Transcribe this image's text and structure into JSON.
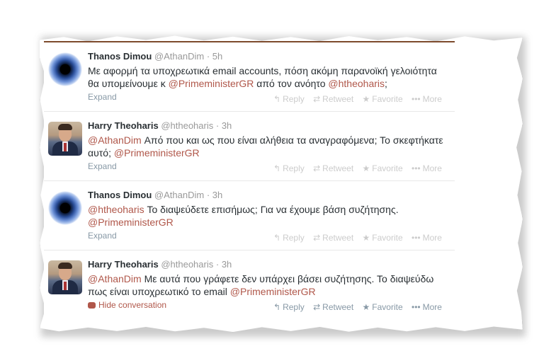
{
  "tweets": [
    {
      "name": "Thanos Dimou",
      "handle": "@AthanDim",
      "time": "5h",
      "avatar": "eye-avatar",
      "text_parts": [
        "Με αφορμή τα υποχρεωτικά email accounts, πόση ακόμη παρανοϊκή γελοιότητα θα υπομείνουμε κ ",
        "@PrimeministerGR",
        " από τον ανόητο ",
        "@htheoharis",
        ";"
      ],
      "footer_link": "Expand"
    },
    {
      "name": "Harry Theoharis",
      "handle": "@htheoharis",
      "time": "3h",
      "avatar": "portrait-avatar",
      "text_parts": [
        "@AthanDim",
        " Από που και ως που είναι αλήθεια τα αναγραφόμενα; Το σκεφτήκατε αυτό; ",
        "@PrimeministerGR"
      ],
      "footer_link": "Expand"
    },
    {
      "name": "Thanos Dimou",
      "handle": "@AthanDim",
      "time": "3h",
      "avatar": "eye-avatar",
      "text_parts": [
        "@htheoharis",
        " Το διαψεύδετε επισήμως; Για να έχουμε βάση συζήτησης. ",
        "@PrimeministerGR"
      ],
      "footer_link": "Expand"
    },
    {
      "name": "Harry Theoharis",
      "handle": "@htheoharis",
      "time": "3h",
      "avatar": "portrait-avatar",
      "text_parts": [
        "@AthanDim",
        " Με αυτά που γράφετε δεν υπάρχει βάσει συζήτησης. Το διαψεύδω πως είναι υποχρεωτικό το email ",
        "@PrimeministerGR"
      ],
      "footer_link": "Hide conversation"
    }
  ],
  "actions": {
    "reply": "Reply",
    "retweet": "Retweet",
    "favorite": "Favorite",
    "more": "More"
  },
  "colors": {
    "link": "#b0574a",
    "muted": "#999999",
    "action_faded": "#cccccc",
    "action_active": "#8899a6"
  }
}
